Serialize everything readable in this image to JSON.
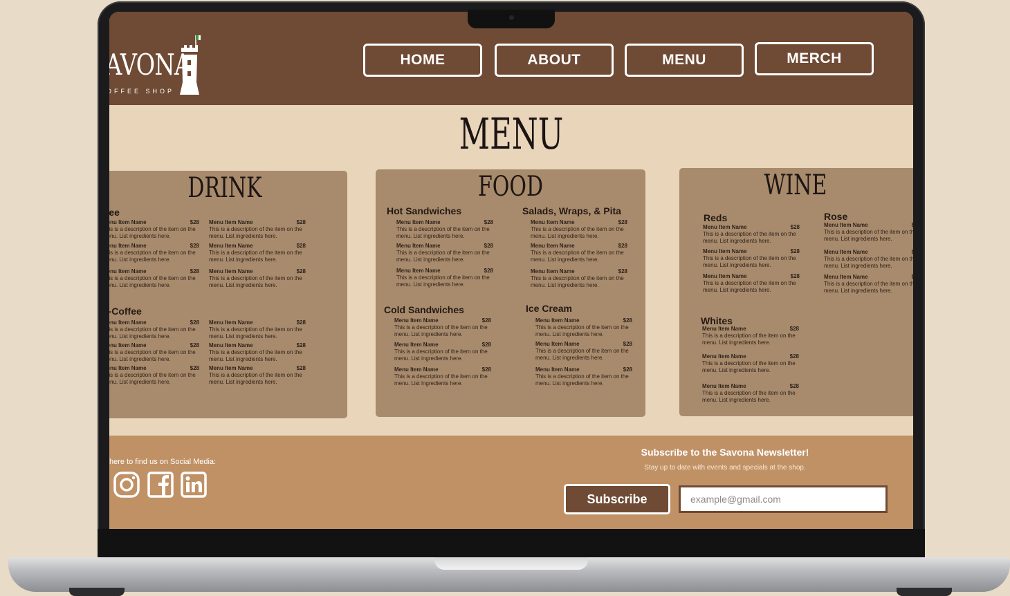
{
  "brand": {
    "name": "AVONA",
    "subtitle": "OFFEE SHOP"
  },
  "nav": [
    {
      "label": "HOME"
    },
    {
      "label": "ABOUT"
    },
    {
      "label": "MENU"
    },
    {
      "label": "MERCH"
    }
  ],
  "page_title": "MENU",
  "cards": {
    "drink": {
      "title": "DRINK",
      "sections": [
        {
          "name": "ffee"
        },
        {
          "name": "n-Coffee"
        }
      ]
    },
    "food": {
      "title": "FOOD",
      "sections": [
        {
          "name": "Hot Sandwiches"
        },
        {
          "name": "Salads, Wraps, & Pita"
        },
        {
          "name": "Cold Sandwiches"
        },
        {
          "name": "Ice Cream"
        }
      ]
    },
    "wine": {
      "title": "WINE",
      "sections": [
        {
          "name": "Reds"
        },
        {
          "name": "Rose"
        },
        {
          "name": "Whites"
        }
      ]
    }
  },
  "menu_item": {
    "name": "Menu Item Name",
    "price": "$28",
    "description": "This is a description of the item on the menu. List ingredients here."
  },
  "footer": {
    "social_text": "here to find us on Social Media:",
    "social_icons": [
      "instagram-icon",
      "facebook-icon",
      "linkedin-icon"
    ],
    "newsletter_title": "Subscribe to the Savona Newsletter!",
    "newsletter_subtitle": "Stay up to date with events and specials at the shop.",
    "subscribe_label": "Subscribe",
    "email_placeholder": "example@gmail.com"
  },
  "colors": {
    "header": "#6f4a34",
    "background": "#e8d5ba",
    "card": "#a88a6c",
    "footer": "#c19166",
    "text_dark": "#1d1612"
  }
}
